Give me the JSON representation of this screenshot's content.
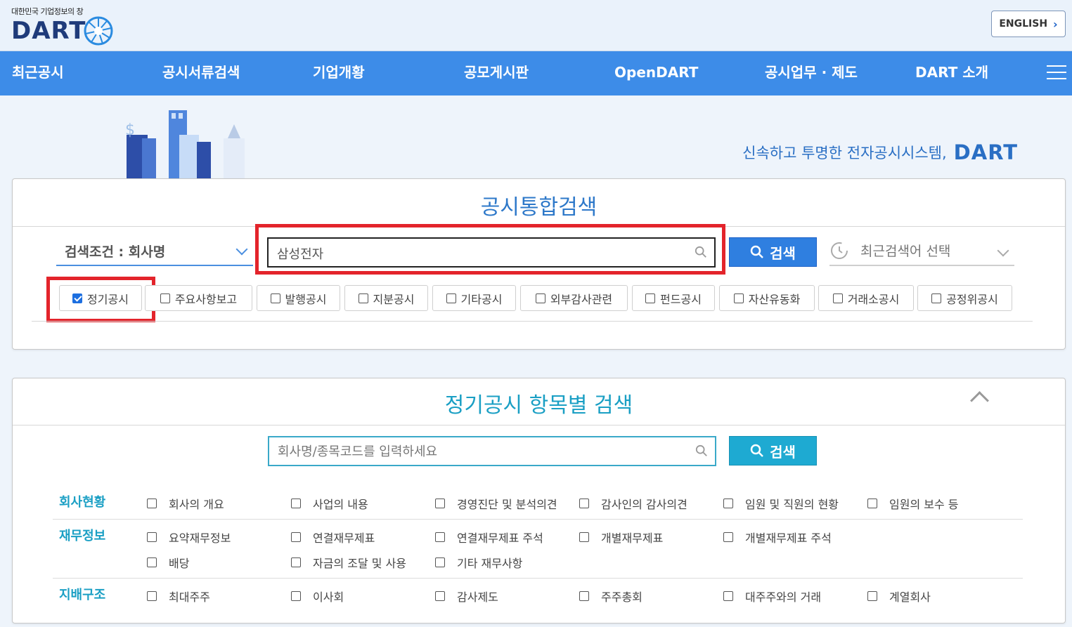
{
  "header": {
    "logo_subtitle": "대한민국 기업정보의 창",
    "logo_text": "DART",
    "english_label": "ENGLISH"
  },
  "nav": {
    "items": [
      {
        "label": "최근공시"
      },
      {
        "label": "공시서류검색"
      },
      {
        "label": "기업개황"
      },
      {
        "label": "공모게시판"
      },
      {
        "label": "OpenDART"
      },
      {
        "label": "공시업무 · 제도"
      },
      {
        "label": "DART 소개"
      }
    ]
  },
  "hero": {
    "tagline": "신속하고 투명한 전자공시시스템,",
    "tagline_brand": "DART"
  },
  "integrated_search": {
    "title": "공시통합검색",
    "condition_label": "검색조건 : 회사명",
    "search_value": "삼성전자",
    "search_button": "검색",
    "recent_label": "최근검색어 선택",
    "filters": [
      {
        "label": "정기공시",
        "checked": true
      },
      {
        "label": "주요사항보고",
        "checked": false
      },
      {
        "label": "발행공시",
        "checked": false
      },
      {
        "label": "지분공시",
        "checked": false
      },
      {
        "label": "기타공시",
        "checked": false
      },
      {
        "label": "외부감사관련",
        "checked": false
      },
      {
        "label": "펀드공시",
        "checked": false
      },
      {
        "label": "자산유동화",
        "checked": false
      },
      {
        "label": "거래소공시",
        "checked": false
      },
      {
        "label": "공정위공시",
        "checked": false
      }
    ]
  },
  "periodic_search": {
    "title": "정기공시 항목별 검색",
    "placeholder": "회사명/종목코드를 입력하세요",
    "search_button": "검색",
    "sections": [
      {
        "label": "회사현황",
        "items": [
          "회사의 개요",
          "사업의 내용",
          "경영진단 및 분석의견",
          "감사인의 감사의견",
          "임원 및 직원의 현황",
          "임원의 보수 등"
        ]
      },
      {
        "label": "재무정보",
        "items": [
          "요약재무정보",
          "연결재무제표",
          "연결재무제표 주석",
          "개별재무제표",
          "개별재무제표 주석",
          "배당",
          "자금의 조달 및 사용",
          "기타 재무사항"
        ]
      },
      {
        "label": "지배구조",
        "items": [
          "최대주주",
          "이사회",
          "감사제도",
          "주주총회",
          "대주주와의 거래",
          "계열회사"
        ]
      }
    ]
  },
  "colors": {
    "nav_bg": "#3d8ce8",
    "highlight": "#e3242b",
    "primary_button": "#2f7fe0",
    "secondary_button": "#1eaad2"
  }
}
